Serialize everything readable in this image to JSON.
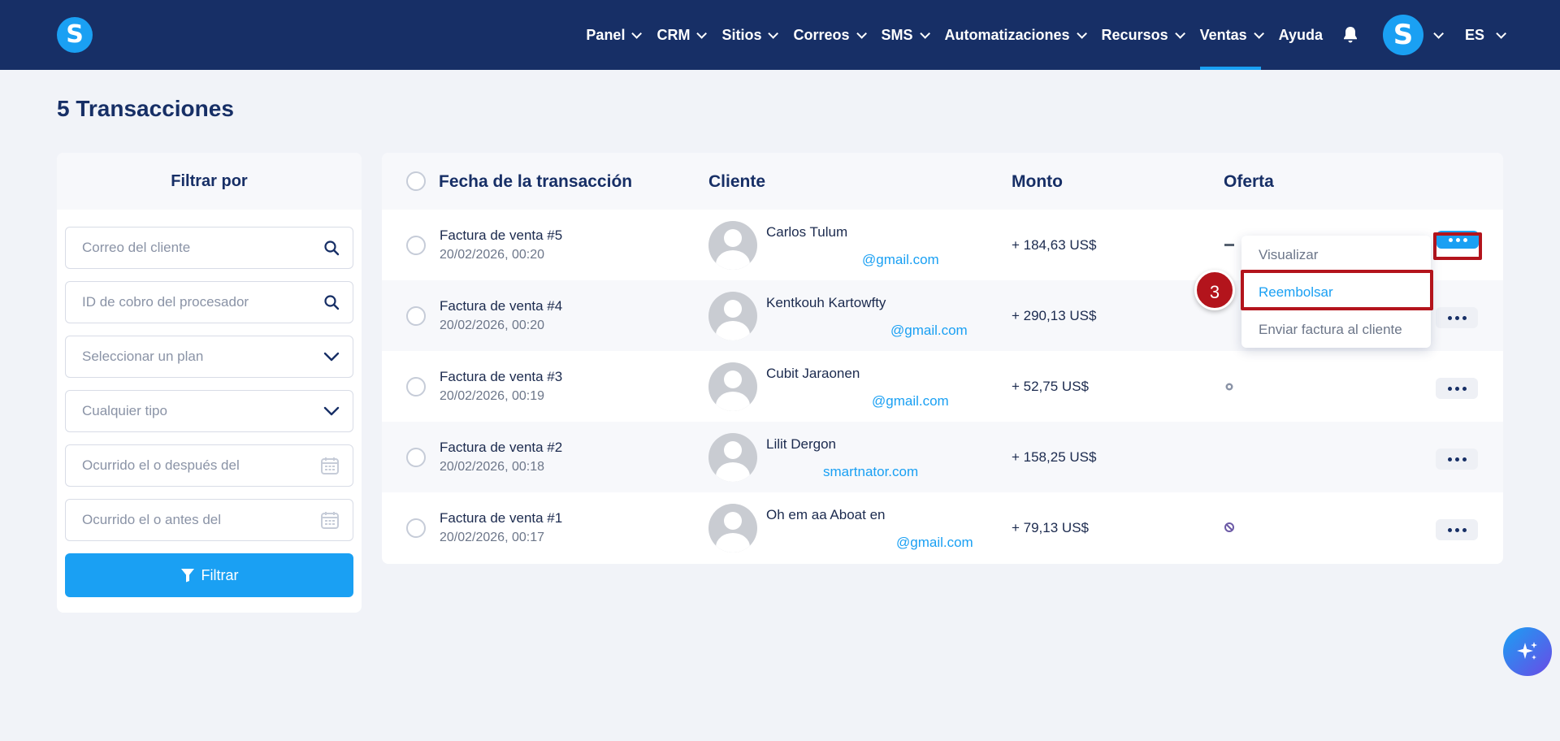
{
  "nav": {
    "logo": "S",
    "items": [
      {
        "label": "Panel",
        "dropdown": true
      },
      {
        "label": "CRM",
        "dropdown": true
      },
      {
        "label": "Sitios",
        "dropdown": true
      },
      {
        "label": "Correos",
        "dropdown": true
      },
      {
        "label": "SMS",
        "dropdown": true
      },
      {
        "label": "Automatizaciones",
        "dropdown": true
      },
      {
        "label": "Recursos",
        "dropdown": true
      },
      {
        "label": "Ventas",
        "dropdown": true,
        "active": true
      },
      {
        "label": "Ayuda",
        "dropdown": false
      }
    ],
    "avatar_letter": "S",
    "language": "ES"
  },
  "page": {
    "title": "5 Transacciones"
  },
  "filter": {
    "heading": "Filtrar por",
    "email_placeholder": "Correo del cliente",
    "processor_placeholder": "ID de cobro del procesador",
    "plan_placeholder": "Seleccionar un plan",
    "type_placeholder": "Cualquier tipo",
    "after_placeholder": "Ocurrido el o después del",
    "before_placeholder": "Ocurrido el o antes del",
    "button_label": "Filtrar"
  },
  "table": {
    "columns": [
      "Fecha de la transacción",
      "Cliente",
      "Monto",
      "Oferta"
    ],
    "rows": [
      {
        "invoice": "Factura de venta #5",
        "date": "20/02/2026, 00:20",
        "name": "Carlos Tulum",
        "email": "@gmail.com",
        "amount": "+ 184,63 US$"
      },
      {
        "invoice": "Factura de venta #4",
        "date": "20/02/2026, 00:20",
        "name": "Kentkouh Kartowfty",
        "email": "@gmail.com",
        "amount": "+ 290,13 US$"
      },
      {
        "invoice": "Factura de venta #3",
        "date": "20/02/2026, 00:19",
        "name": "Cubit Jaraonen",
        "email": "@gmail.com",
        "amount": "+ 52,75 US$"
      },
      {
        "invoice": "Factura de venta #2",
        "date": "20/02/2026, 00:18",
        "name": "Lilit Dergon",
        "email": "smartnator.com",
        "amount": "+ 158,25 US$"
      },
      {
        "invoice": "Factura de venta #1",
        "date": "20/02/2026, 00:17",
        "name": "Oh em aa Aboat en",
        "email": "@gmail.com",
        "amount": "+ 79,13 US$"
      }
    ]
  },
  "menu": {
    "items": [
      "Visualizar",
      "Reembolsar",
      "Enviar factura al cliente"
    ]
  },
  "annotation": {
    "step": "3",
    "color": "#b3141c"
  },
  "colors": {
    "nav_bg": "#172f66",
    "accent": "#1aa0f3"
  }
}
